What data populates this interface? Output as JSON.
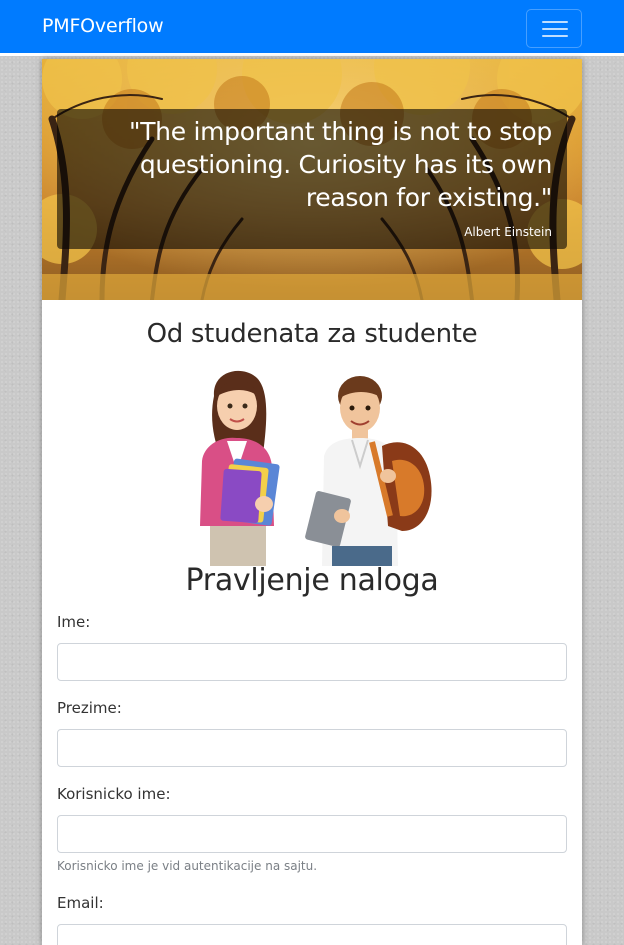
{
  "navbar": {
    "brand": "PMFOverflow",
    "menu_icon": "hamburger-icon"
  },
  "hero": {
    "quote": "\"The important thing is not to stop questioning. Curiosity has its own reason for existing.\"",
    "author": "Albert Einstein"
  },
  "main": {
    "subtitle": "Od studenata za studente",
    "form_title": "Pravljenje naloga"
  },
  "form": {
    "fields": [
      {
        "label": "Ime:",
        "value": ""
      },
      {
        "label": "Prezime:",
        "value": ""
      },
      {
        "label": "Korisnicko ime:",
        "value": "",
        "help": "Korisnicko ime je vid autentikacije na sajtu."
      },
      {
        "label": "Email:",
        "value": ""
      }
    ]
  },
  "colors": {
    "navbar": "#007bff",
    "page_background": "#c9c9c9",
    "text": "#2a2a2a"
  }
}
